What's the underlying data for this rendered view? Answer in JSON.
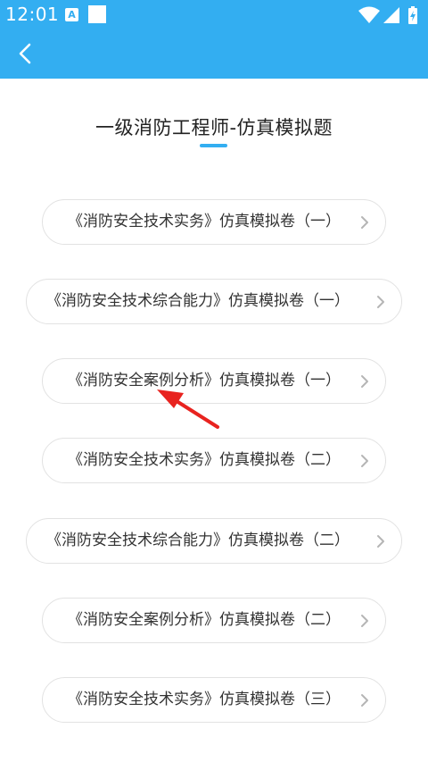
{
  "status_bar": {
    "time": "12:01",
    "notification_letter": "A",
    "icons": [
      "wifi-icon",
      "signal-icon",
      "battery-charging-icon"
    ]
  },
  "app_bar": {
    "back_icon": "chevron-left-icon",
    "color": "#33aef1"
  },
  "page": {
    "title": "一级消防工程师-仿真模拟题",
    "accent": "#33aef1"
  },
  "exam_list": [
    {
      "label": "《消防安全技术实务》仿真模拟卷（一）",
      "icon": "chevron-right-icon"
    },
    {
      "label": "《消防安全技术综合能力》仿真模拟卷（一）",
      "icon": "chevron-right-icon"
    },
    {
      "label": "《消防安全案例分析》仿真模拟卷（一）",
      "icon": "chevron-right-icon"
    },
    {
      "label": "《消防安全技术实务》仿真模拟卷（二）",
      "icon": "chevron-right-icon"
    },
    {
      "label": "《消防安全技术综合能力》仿真模拟卷（二）",
      "icon": "chevron-right-icon"
    },
    {
      "label": "《消防安全案例分析》仿真模拟卷（二）",
      "icon": "chevron-right-icon"
    },
    {
      "label": "《消防安全技术实务》仿真模拟卷（三）",
      "icon": "chevron-right-icon"
    }
  ],
  "annotation": {
    "icon": "red-arrow-icon",
    "color": "#e8231f"
  }
}
